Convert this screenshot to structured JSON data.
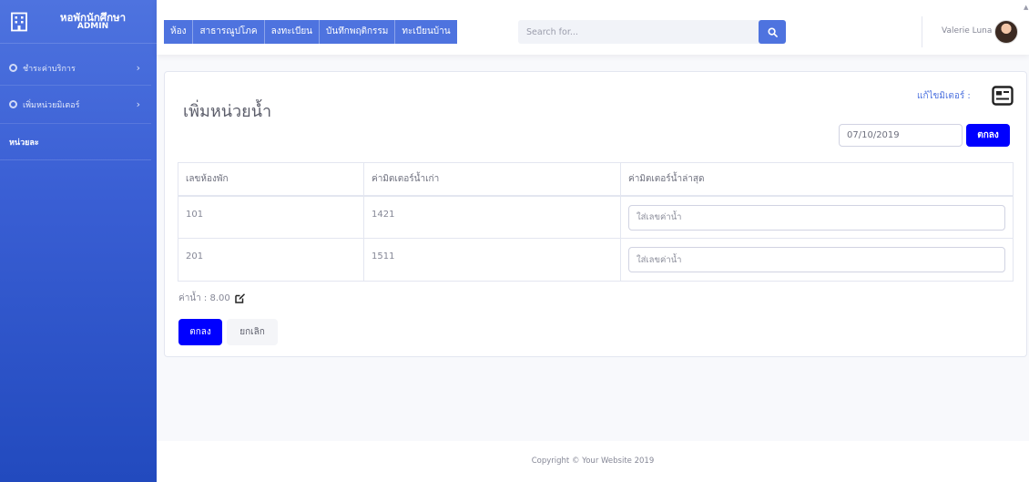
{
  "brand": {
    "title": "หอพักนักศึกษา",
    "subtitle": "ADMIN",
    "icon": "building-icon"
  },
  "sidebar": {
    "items": [
      {
        "label": "ชำระค่าบริการ",
        "icon": "circle-icon"
      },
      {
        "label": "เพิ่มหน่วยมิเตอร์",
        "icon": "circle-icon"
      }
    ],
    "static_label": "หน่วยละ"
  },
  "topbar": {
    "menu": [
      "ห้อง",
      "สาธารณูปโภค",
      "ลงทะเบียน",
      "บันทึกพฤติกรรม",
      "ทะเบียนบ้าน"
    ],
    "search_placeholder": "Search for...",
    "user_name": "Valerie Luna"
  },
  "page": {
    "title": "เพิ่มหน่วยน้ำ",
    "meter_edit_label": "แก้ไขมิเตอร์ :",
    "date_value": "07/10/2019",
    "date_ok_label": "ตกลง"
  },
  "table": {
    "headers": [
      "เลขห้องพัก",
      "ค่ามิตเตอร์น้ำเก่า",
      "ค่ามิตเตอร์น้ำล่าสุด"
    ],
    "rows": [
      {
        "room": "101",
        "old_meter": "1421",
        "placeholder": "ใส่เลขค่าน้ำ"
      },
      {
        "room": "201",
        "old_meter": "1511",
        "placeholder": "ใส่เลขค่าน้ำ"
      }
    ]
  },
  "rate": {
    "text": "ค่าน้ำ : 8.00"
  },
  "actions": {
    "ok_label": "ตกลง",
    "cancel_label": "ยกเลิก"
  },
  "footer": {
    "text": "Copyright © Your Website 2019"
  },
  "colors": {
    "primary": "#4e73df",
    "button_blue": "#0000ff"
  }
}
